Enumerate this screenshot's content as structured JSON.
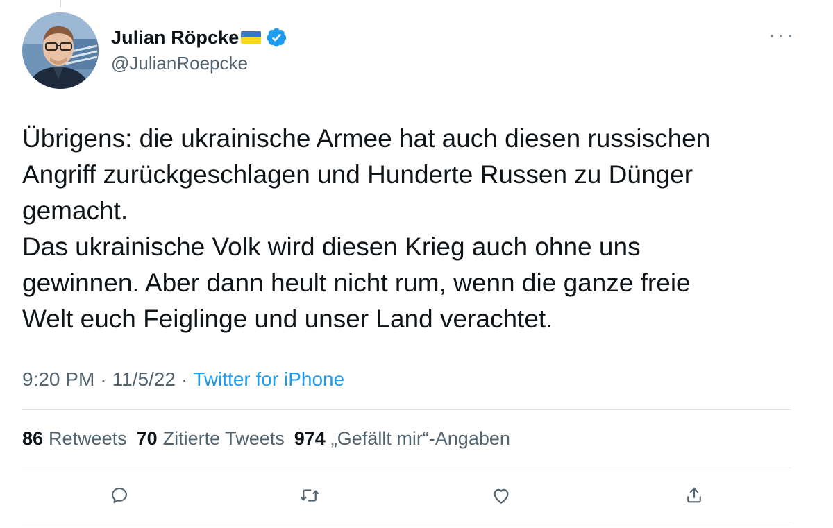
{
  "tweet": {
    "author": {
      "display_name": "Julian Röpcke",
      "handle": "@JulianRoepcke",
      "flag_icon": "ukraine-flag-icon",
      "verified_icon": "verified-badge-icon",
      "verified_color": "#1d9bf0"
    },
    "text": "Übrigens: die ukrainische Armee hat auch diesen russischen\nAngriff zurückgeschlagen und Hunderte Russen zu Dünger\ngemacht.\nDas ukrainische Volk wird diesen Krieg auch ohne uns\ngewinnen. Aber dann heult nicht rum, wenn die ganze freie\nWelt euch Feiglinge und unser Land verachtet.",
    "time": "9:20 PM",
    "separator": "·",
    "date": "11/5/22",
    "source": "Twitter for iPhone",
    "stats": {
      "retweets_count": "86",
      "retweets_label": "Retweets",
      "quotes_count": "70",
      "quotes_label": "Zitierte Tweets",
      "likes_count": "974",
      "likes_label": "„Gefällt mir“-Angaben"
    },
    "actions": [
      {
        "icon": "reply-icon"
      },
      {
        "icon": "retweet-icon"
      },
      {
        "icon": "like-icon"
      },
      {
        "icon": "share-icon"
      }
    ],
    "more_icon": "more-options-icon"
  },
  "colors": {
    "text_primary": "#0f1419",
    "text_secondary": "#536471",
    "accent": "#1d9bf0",
    "divider": "#e1e6ea"
  }
}
